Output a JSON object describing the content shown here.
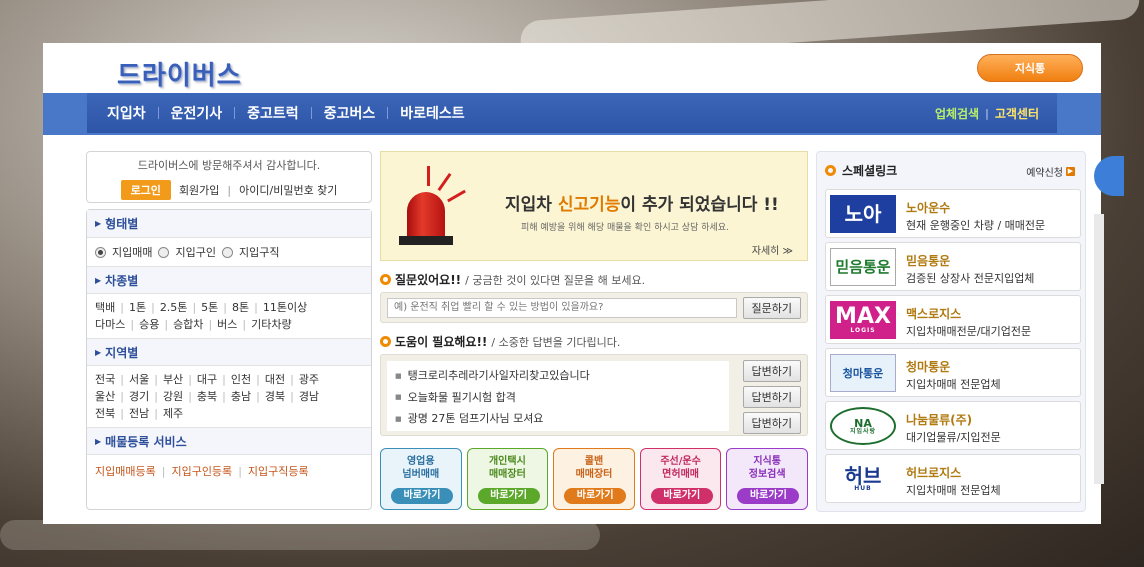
{
  "header": {
    "logo": "드라이버스",
    "top_button": "지식통"
  },
  "nav": {
    "items": [
      "지입차",
      "운전기사",
      "중고트럭",
      "중고버스",
      "바로테스트"
    ],
    "right": [
      "업체검색",
      "고객센터"
    ],
    "right_sep": "|"
  },
  "welcome": {
    "message": "드라이버스에 방문해주셔서 감사합니다.",
    "login": "로그인",
    "join": "회원가입",
    "sep": "|",
    "find": "아이디/비밀번호 찾기"
  },
  "filters": {
    "type": {
      "title": "형태별",
      "options": [
        "지입매매",
        "지입구인",
        "지입구직"
      ],
      "selected": "지입매매"
    },
    "vehicle": {
      "title": "차종별",
      "row1": [
        "택배",
        "1톤",
        "2.5톤",
        "5톤",
        "8톤",
        "11톤이상"
      ],
      "row2": [
        "다마스",
        "승용",
        "승합차",
        "버스",
        "기타차량"
      ]
    },
    "region": {
      "title": "지역별",
      "row1": [
        "전국",
        "서울",
        "부산",
        "대구",
        "인천",
        "대전",
        "광주"
      ],
      "row2": [
        "울산",
        "경기",
        "강원",
        "충북",
        "충남",
        "경북",
        "경남"
      ],
      "row3": [
        "전북",
        "전남",
        "제주"
      ]
    },
    "service": {
      "title": "매물등록 서비스",
      "links": [
        "지입매매등록",
        "지입구인등록",
        "지입구직등록"
      ]
    }
  },
  "banner": {
    "headline_pre": "지입차",
    "headline_highlight": "신고기능",
    "headline_post": "이 추가 되었습니다 !!",
    "sub": "피해 예방을 위해 해당 매물을 확인 하시고 상담 하세요.",
    "more": "자세히 ≫"
  },
  "question": {
    "title": "질문있어요!!",
    "desc": "/ 궁금한 것이 있다면 질문을 해 보세요.",
    "placeholder": "예) 운전직 취업 빨리 할 수 있는 방법이 있을까요?",
    "button": "질문하기"
  },
  "help": {
    "title": "도움이 필요해요!!",
    "desc": "/ 소중한 답변을 기다립니다.",
    "items": [
      "탱크로리추레라기사일자리찾고있습니다",
      "오늘화물 필기시험 합격",
      "광명 27톤 덤프기사님 모셔요"
    ],
    "button": "답변하기"
  },
  "tiles": [
    {
      "line1": "영업용",
      "line2": "넘버매매",
      "go": "바로가기",
      "color": "#3a8fb8",
      "bg": "#e8f4fa",
      "text": "#2a6fa0"
    },
    {
      "line1": "개인택시",
      "line2": "매매장터",
      "go": "바로가기",
      "color": "#5ba82a",
      "bg": "#eef7e4",
      "text": "#4c8a1e"
    },
    {
      "line1": "콜밴",
      "line2": "매매장터",
      "go": "바로가기",
      "color": "#e07a1a",
      "bg": "#fdf1e2",
      "text": "#c8641a"
    },
    {
      "line1": "주선/운수",
      "line2": "면허매매",
      "go": "바로가기",
      "color": "#d0306a",
      "bg": "#fbe8ef",
      "text": "#c02a5e"
    },
    {
      "line1": "지식통",
      "line2": "정보검색",
      "go": "바로가기",
      "color": "#9a3cc8",
      "bg": "#f3e8fa",
      "text": "#8a30b8"
    }
  ],
  "special": {
    "title": "스페셜링크",
    "more": "예약신청",
    "items": [
      {
        "logo": "노아",
        "name": "노아운수",
        "desc": "현재 운행중인 차량 / 매매전문"
      },
      {
        "logo": "믿음통운",
        "name": "믿음통운",
        "desc": "검증된 상장사 전문지입업체"
      },
      {
        "logo": "MAX",
        "logo_sub": "LOGIS",
        "name": "맥스로지스",
        "desc": "지입차매매전문/대기업전문"
      },
      {
        "logo": "청마통운",
        "name": "청마통운",
        "desc": "지입차매매 전문업체"
      },
      {
        "logo": "NA",
        "logo_sub": "지입사랑",
        "name": "나눔물류(주)",
        "desc": "대기업물류/지입전문"
      },
      {
        "logo": "허브",
        "logo_sub": "HUB",
        "name": "허브로지스",
        "desc": "지입차매매 전문업체"
      }
    ]
  }
}
